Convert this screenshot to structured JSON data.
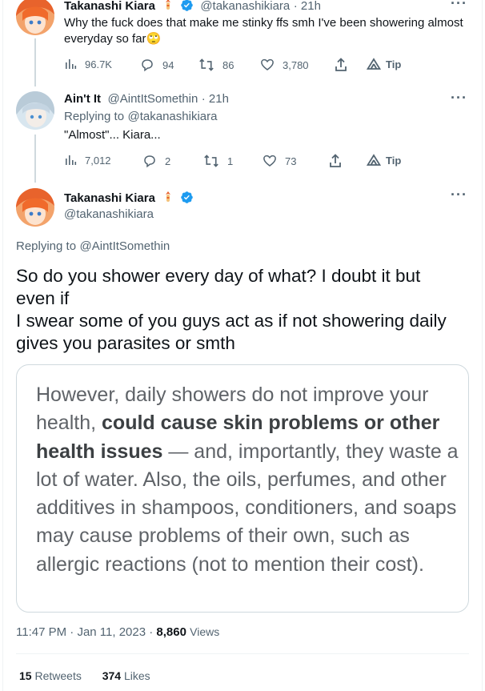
{
  "tweet1": {
    "name": "Takanashi Kiara",
    "handle": "@takanashikiara",
    "time": "21h",
    "text": "Why the fuck does that make me stinky ffs smh I've been showering almost everyday so far",
    "emoji": "🙄",
    "views": "96.7K",
    "replies": "94",
    "retweets": "86",
    "likes": "3,780",
    "tip": "Tip"
  },
  "tweet2": {
    "name": "Ain't It",
    "handle": "@AintItSomethin",
    "time": "21h",
    "replying_prefix": "Replying to",
    "replying_to": "@takanashikiara",
    "text": "\"Almost\"... Kiara...",
    "views": "7,012",
    "replies": "2",
    "retweets": "1",
    "likes": "73",
    "tip": "Tip"
  },
  "main": {
    "name": "Takanashi Kiara",
    "handle": "@takanashikiara",
    "replying_prefix": "Replying to",
    "replying_to": "@AintItSomethin",
    "text_line1": "So do you shower every day of what? I doubt it but even if",
    "text_line2": "I swear some of you guys act as if not showering daily gives you parasites or smth",
    "image_text_part1": "However, daily showers do not improve your health,",
    "image_text_bold": "could cause skin problems or other health issues",
    "image_text_part2": "— and, importantly, they waste a lot of water. Also, the oils, perfumes, and other additives in shampoos, conditioners, and soaps may cause problems of their own, such as allergic reactions (not to mention their cost).",
    "time": "11:47 PM",
    "date": "Jan 11, 2023",
    "views": "8,860",
    "views_label": "Views",
    "retweets": "15",
    "retweets_label": "Retweets",
    "likes": "374",
    "likes_label": "Likes"
  },
  "colors": {
    "accent": "#1d9bf0",
    "verified": "#1d9bf0",
    "muted": "#536471"
  }
}
